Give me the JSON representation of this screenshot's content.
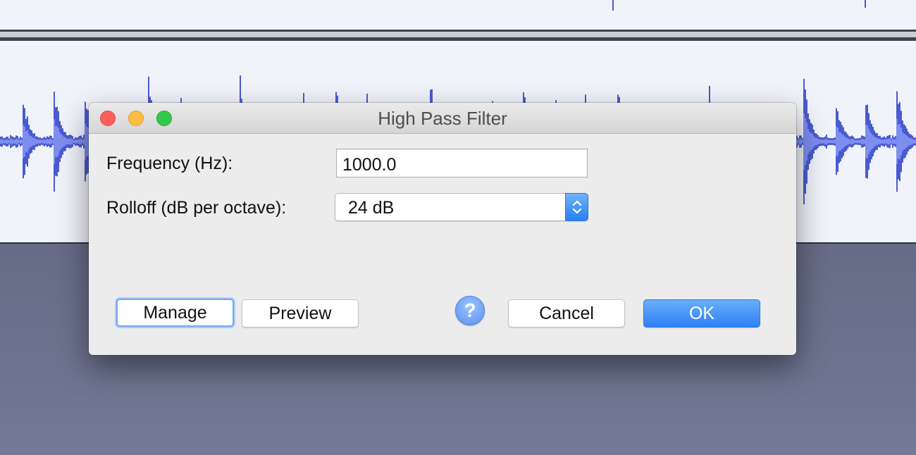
{
  "background": {
    "waveform_color": "#4a5bd0",
    "waveform_light_color": "#7e8ef0"
  },
  "dialog": {
    "title": "High Pass Filter",
    "window_controls": [
      "close-icon",
      "minimize-icon",
      "zoom-icon"
    ],
    "frequency": {
      "label": "Frequency (Hz):",
      "value": "1000.0"
    },
    "rolloff": {
      "label": "Rolloff (dB per octave):",
      "selected": "24 dB"
    },
    "buttons": {
      "manage": "Manage",
      "preview": "Preview",
      "help": "?",
      "cancel": "Cancel",
      "ok": "OK"
    },
    "accent_color": "#2e80f4"
  }
}
